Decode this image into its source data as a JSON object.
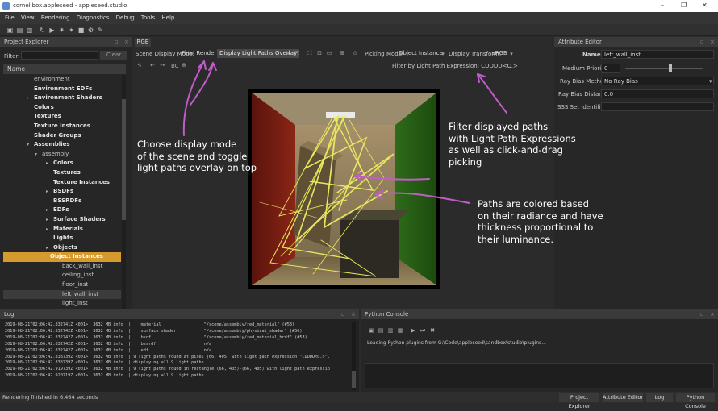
{
  "window": {
    "title": "cornellbox.appleseed - appleseed.studio",
    "min": "–",
    "max": "❐",
    "close": "✕"
  },
  "menu": [
    "File",
    "View",
    "Rendering",
    "Diagnostics",
    "Debug",
    "Tools",
    "Help"
  ],
  "project_explorer": {
    "title": "Project Explorer",
    "filter_label": "Filter:",
    "clear_label": "Clear",
    "column_name": "Name",
    "tree": [
      {
        "label": "environment",
        "leaf": true
      },
      {
        "label": "Environment EDFs"
      },
      {
        "label": "Environment Shaders",
        "arrow": "▸"
      },
      {
        "label": "Colors"
      },
      {
        "label": "Textures"
      },
      {
        "label": "Texture Instances"
      },
      {
        "label": "Shader Groups"
      },
      {
        "label": "Assemblies",
        "arrow": "▾"
      },
      {
        "label": "assembly",
        "leaf": true,
        "arrow": "▾"
      },
      {
        "label": "Colors",
        "arrow": "▸"
      },
      {
        "label": "Textures"
      },
      {
        "label": "Texture Instances"
      },
      {
        "label": "BSDFs",
        "arrow": "▸"
      },
      {
        "label": "BSSRDFs"
      },
      {
        "label": "EDFs",
        "arrow": "▸"
      },
      {
        "label": "Surface Shaders",
        "arrow": "▸"
      },
      {
        "label": "Materials",
        "arrow": "▸"
      },
      {
        "label": "Lights"
      },
      {
        "label": "Objects",
        "arrow": "▸"
      },
      {
        "label": "Object Instances",
        "arrow": "▾",
        "selected": true
      },
      {
        "label": "back_wall_inst",
        "leaf": true
      },
      {
        "label": "ceiling_inst",
        "leaf": true
      },
      {
        "label": "floor_inst",
        "leaf": true
      },
      {
        "label": "left_wall_inst",
        "leaf": true,
        "current": true
      },
      {
        "label": "light_inst",
        "leaf": true
      }
    ]
  },
  "viewport": {
    "tab": "RGB",
    "scene_display_mode_label": "Scene Display Mode:",
    "scene_display_mode_value": "Final Render",
    "overlay_button": "Display Light Paths Overlay",
    "picking_mode_label": "Picking Mode:",
    "picking_mode_value": "Object Instance",
    "display_transform_label": "Display Transform:",
    "display_transform_value": "sRGB",
    "bc_label": "BC",
    "filter_lpe": "Filter by Light Path Expression: CDDDD<O.>"
  },
  "attribute_editor": {
    "title": "Attribute Editor",
    "fields": [
      {
        "label": "Name:",
        "value": "left_wall_inst"
      },
      {
        "label": "Medium Priority:",
        "value": "0"
      },
      {
        "label": "Ray Bias Method:",
        "value": "No Ray Bias"
      },
      {
        "label": "Ray Bias Distance:",
        "value": "0.0"
      },
      {
        "label": "SSS Set Identifier:",
        "value": ""
      }
    ]
  },
  "annotations": {
    "left": [
      "Choose display mode",
      "of the scene and toggle",
      "light paths overlay on top"
    ],
    "right_top": [
      "Filter displayed paths",
      "with Light Path Expressions",
      "as well as click-and-drag",
      "picking"
    ],
    "right_bottom": [
      "Paths are colored based",
      "on their radiance and have",
      "thickness proportional to",
      "their luminance."
    ]
  },
  "log": {
    "title": "Log",
    "lines": [
      "2019-08-21T02:06:42.832741Z <001>  3632 MB info  |    material                 \"/scene/assembly/red_material\" (#53)",
      "2019-08-21T02:06:42.832742Z <001>  3632 MB info  |    surface shader           \"/scene/assembly/physical_shader\" (#56)",
      "2019-08-21T02:06:42.832742Z <001>  3632 MB info  |    bsdf                     \"/scene/assembly/red_material_brdf\" (#53)",
      "2019-08-21T02:06:42.832742Z <001>  3632 MB info  |    bssrdf                   n/a",
      "2019-08-21T02:06:42.832742Z <001>  3632 MB info  |    edf                      n/a",
      "2019-08-21T02:06:42.838739Z <001>  3632 MB info  | 9 light paths found at pixel (66, 405) with light path expression \"CDDDD<O.>\".",
      "2019-08-21T02:06:42.838739Z <001>  3632 MB info  | displaying all 9 light paths.",
      "2019-08-21T02:06:42.919739Z <001>  3632 MB info  | 9 light paths found in rectangle (66, 405)-(66, 405) with light path expressio",
      "2019-08-21T02:06:42.920719Z <001>  3632 MB info  | displaying all 9 light paths."
    ]
  },
  "python": {
    "title": "Python Console",
    "output": "Loading Python plugins from G:\\Code\\appleseed\\sandbox\\studio\\plugins..."
  },
  "status": {
    "text": "Rendering finished in 6.464 seconds",
    "tabs": [
      "Project Explorer",
      "Attribute Editor",
      "Log",
      "Python Console"
    ]
  }
}
